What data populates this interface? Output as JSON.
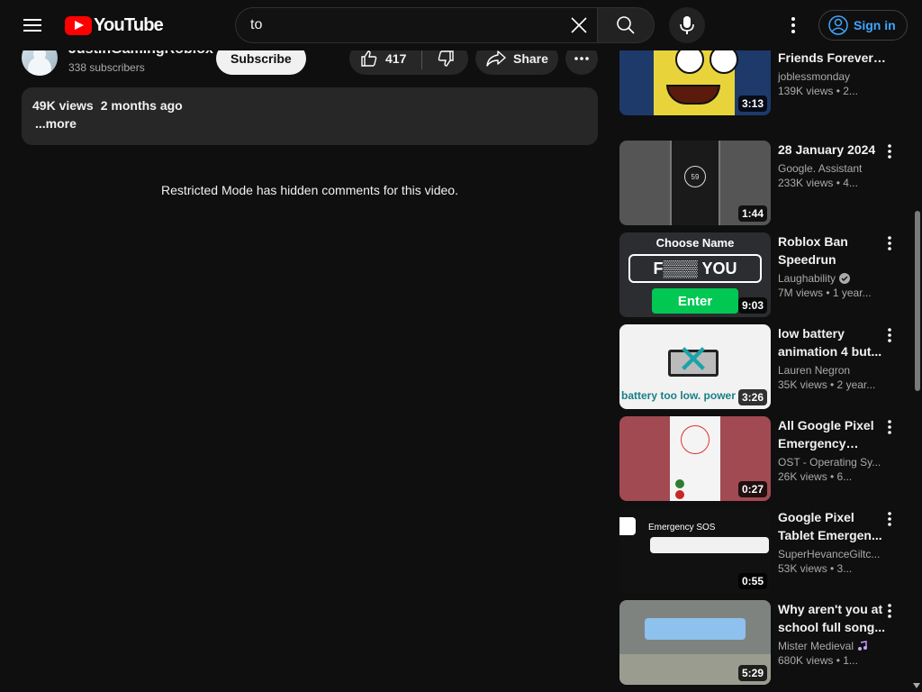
{
  "masthead": {
    "logo_text": "YouTube",
    "search_value": "to",
    "signin_label": "Sign in"
  },
  "owner": {
    "channel_name": "JustinGamingRoblox",
    "subscribers": "338 subscribers",
    "subscribe_label": "Subscribe",
    "like_count": "417",
    "share_label": "Share"
  },
  "description": {
    "views": "49K views",
    "date": "2 months ago",
    "more": "...more"
  },
  "comments": {
    "restricted_message": "Restricted Mode has hidden comments for this video."
  },
  "related": [
    {
      "title": "The \"Best Friends Forever\" Attack...",
      "channel": "joblessmonday",
      "stats": "139K views  • 2...",
      "duration": "3:13",
      "verified": false,
      "thumb": "sponge"
    },
    {
      "title": "28 January 2024",
      "channel": "Google. Assistant",
      "stats": "233K views  • 4...",
      "duration": "1:44",
      "verified": false,
      "thumb": "phone",
      "thumb_text": "59"
    },
    {
      "title": "Roblox Ban Speedrun",
      "channel": "Laughability",
      "stats": "7M views  • 1 year...",
      "duration": "9:03",
      "verified": true,
      "thumb": "roblox",
      "thumb_text": [
        "Choose Name",
        "F▒▒▒ YOU",
        "Enter"
      ]
    },
    {
      "title": "low battery animation 4 but...",
      "channel": "Lauren Negron",
      "stats": "35K views  • 2 year...",
      "duration": "3:26",
      "verified": false,
      "thumb": "battery",
      "thumb_text": "battery too low. power"
    },
    {
      "title": "All Google Pixel Emergency SOS...",
      "channel": "OST - Operating Sy...",
      "stats": "26K views  • 6...",
      "duration": "0:27",
      "verified": false,
      "thumb": "sos1"
    },
    {
      "title": "Google Pixel Tablet Emergen...",
      "channel": "SuperHevanceGiltc...",
      "stats": "53K views  • 3...",
      "duration": "0:55",
      "verified": false,
      "thumb": "sos2",
      "thumb_text": "Emergency SOS"
    },
    {
      "title": "Why aren't you at school full song...",
      "channel": "Mister Medieval",
      "stats": "680K views  • 1...",
      "duration": "5:29",
      "verified": false,
      "thumb": "school"
    }
  ]
}
